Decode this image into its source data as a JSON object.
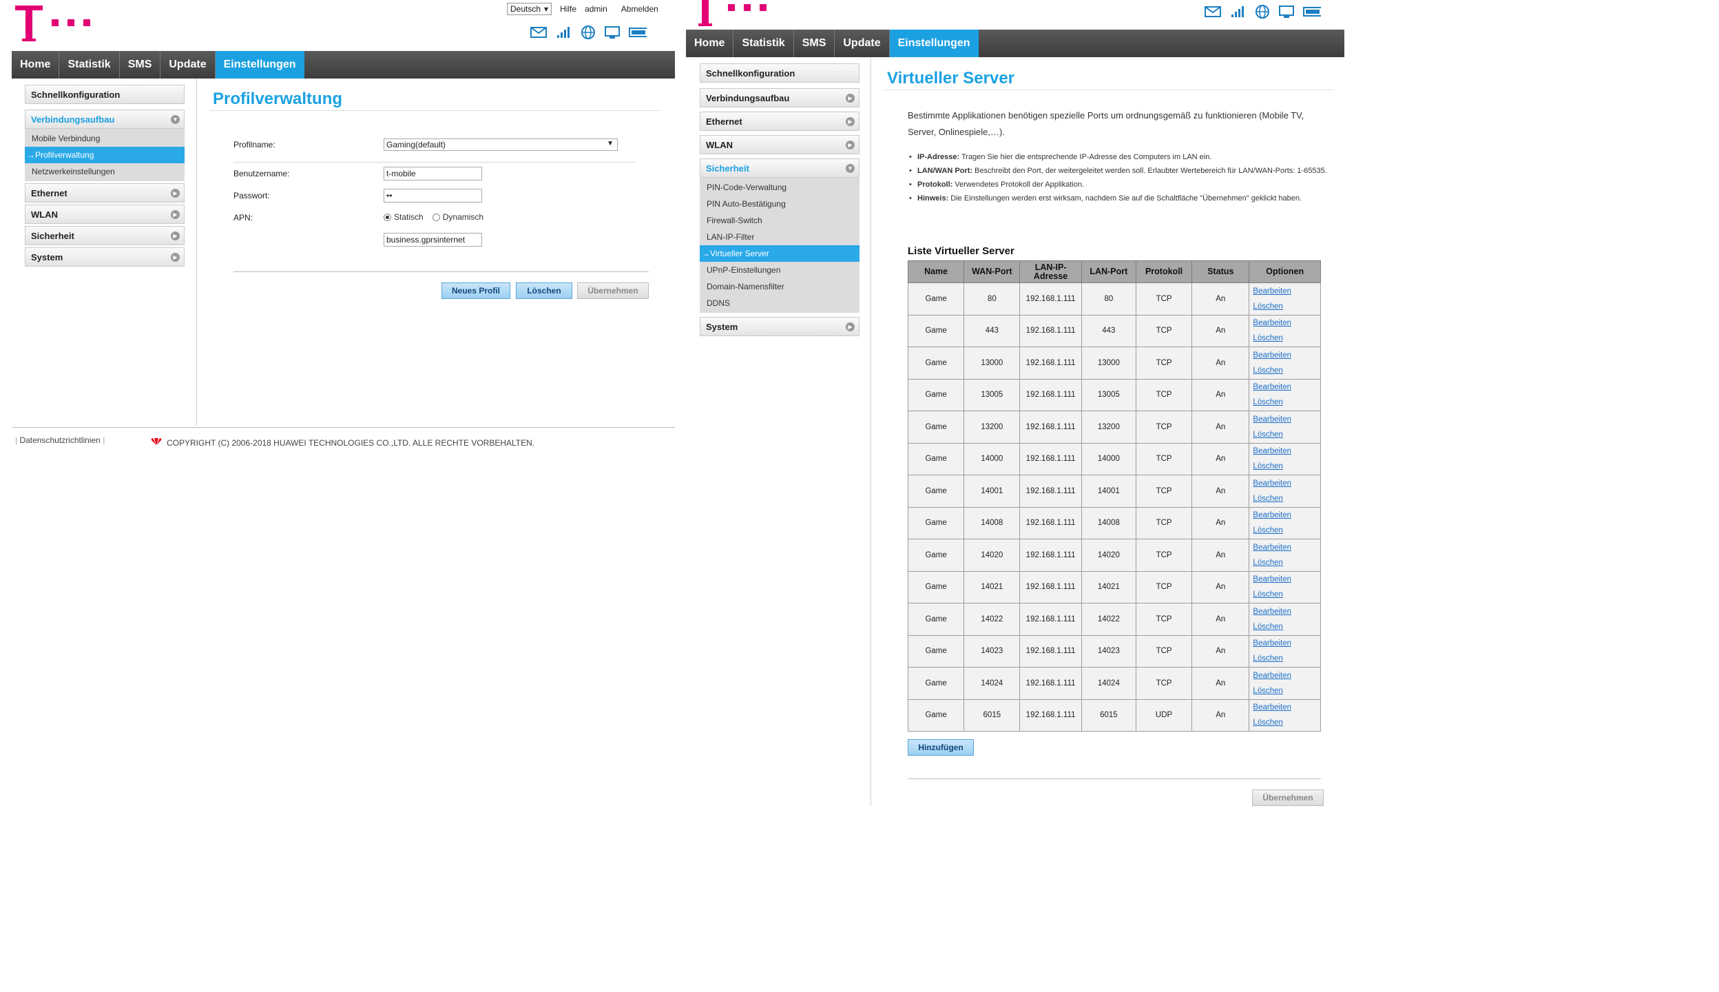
{
  "left": {
    "top_links": {
      "language": "Deutsch",
      "help": "Hilfe",
      "user": "admin",
      "logout": "Abmelden"
    },
    "nav": [
      "Home",
      "Statistik",
      "SMS",
      "Update",
      "Einstellungen"
    ],
    "nav_active": "Einstellungen",
    "sidebar": {
      "quick": "Schnellkonfiguration",
      "connection": "Verbindungsaufbau",
      "connection_sub": [
        "Mobile Verbindung",
        "→Profilverwaltung",
        "Netzwerkeinstellungen"
      ],
      "ethernet": "Ethernet",
      "wlan": "WLAN",
      "security": "Sicherheit",
      "system": "System"
    },
    "title": "Profilverwaltung",
    "form": {
      "profile_label": "Profilname:",
      "profile_value": "Gaming(default)",
      "username_label": "Benutzername:",
      "username_value": "t-mobile",
      "password_label": "Passwort:",
      "password_value": "••",
      "apn_label": "APN:",
      "apn_static": "Statisch",
      "apn_dynamic": "Dynamisch",
      "apn_value": "business.gprsinternet"
    },
    "buttons": {
      "new_profile": "Neues Profil",
      "delete": "Löschen",
      "apply": "Übernehmen"
    },
    "footer": {
      "privacy": "Datenschutzrichtlinien",
      "copyright": "COPYRIGHT (C) 2006-2018 HUAWEI TECHNOLOGIES CO.,LTD. ALLE RECHTE VORBEHALTEN."
    }
  },
  "right": {
    "nav": [
      "Home",
      "Statistik",
      "SMS",
      "Update",
      "Einstellungen"
    ],
    "nav_active": "Einstellungen",
    "sidebar": {
      "quick": "Schnellkonfiguration",
      "connection": "Verbindungsaufbau",
      "ethernet": "Ethernet",
      "wlan": "WLAN",
      "security": "Sicherheit",
      "security_sub": [
        "PIN-Code-Verwaltung",
        "PIN Auto-Bestätigung",
        "Firewall-Switch",
        "LAN-IP-Filter",
        "→Virtueller Server",
        "UPnP-Einstellungen",
        "Domain-Namensfilter",
        "DDNS"
      ],
      "system": "System"
    },
    "title": "Virtueller Server",
    "intro": "Bestimmte Applikationen benötigen spezielle Ports um ordnungsgemäß zu funktionieren (Mobile TV, Server, Onlinespiele,…).",
    "bullets": [
      {
        "term": "IP-Adresse:",
        "text": " Tragen Sie hier die entsprechende IP-Adresse des Computers im LAN ein."
      },
      {
        "term": "LAN/WAN Port:",
        "text": " Beschreibt den Port, der weitergeleitet werden soll. Erlaubter Wertebereich für LAN/WAN-Ports: 1-65535."
      },
      {
        "term": "Protokoll:",
        "text": " Verwendetes Protokoll der Applikation."
      },
      {
        "term": "Hinweis:",
        "text": " Die Einstellungen werden erst wirksam, nachdem Sie auf die Schaltfläche \"Übernehmen\" geklickt haben."
      }
    ],
    "list_title": "Liste Virtueller Server",
    "table": {
      "headers": [
        "Name",
        "WAN-Port",
        "LAN-IP-Adresse",
        "LAN-Port",
        "Protokoll",
        "Status",
        "Optionen"
      ],
      "edit_label": "Bearbeiten",
      "delete_label": "Löschen",
      "rows": [
        [
          "Game",
          "80",
          "192.168.1.111",
          "80",
          "TCP",
          "An"
        ],
        [
          "Game",
          "443",
          "192.168.1.111",
          "443",
          "TCP",
          "An"
        ],
        [
          "Game",
          "13000",
          "192.168.1.111",
          "13000",
          "TCP",
          "An"
        ],
        [
          "Game",
          "13005",
          "192.168.1.111",
          "13005",
          "TCP",
          "An"
        ],
        [
          "Game",
          "13200",
          "192.168.1.111",
          "13200",
          "TCP",
          "An"
        ],
        [
          "Game",
          "14000",
          "192.168.1.111",
          "14000",
          "TCP",
          "An"
        ],
        [
          "Game",
          "14001",
          "192.168.1.111",
          "14001",
          "TCP",
          "An"
        ],
        [
          "Game",
          "14008",
          "192.168.1.111",
          "14008",
          "TCP",
          "An"
        ],
        [
          "Game",
          "14020",
          "192.168.1.111",
          "14020",
          "TCP",
          "An"
        ],
        [
          "Game",
          "14021",
          "192.168.1.111",
          "14021",
          "TCP",
          "An"
        ],
        [
          "Game",
          "14022",
          "192.168.1.111",
          "14022",
          "TCP",
          "An"
        ],
        [
          "Game",
          "14023",
          "192.168.1.111",
          "14023",
          "TCP",
          "An"
        ],
        [
          "Game",
          "14024",
          "192.168.1.111",
          "14024",
          "TCP",
          "An"
        ],
        [
          "Game",
          "6015",
          "192.168.1.111",
          "6015",
          "UDP",
          "An"
        ]
      ]
    },
    "buttons": {
      "add": "Hinzufügen",
      "apply": "Übernehmen"
    }
  }
}
